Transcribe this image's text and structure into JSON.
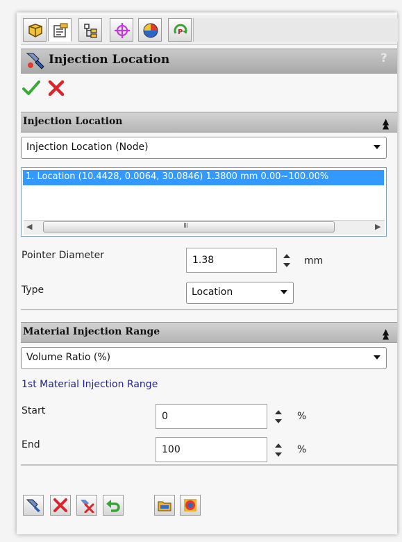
{
  "panel": {
    "title": "Injection Location",
    "help": "?"
  },
  "tabs": [
    {
      "icon": "feature-manager-icon"
    },
    {
      "icon": "property-manager-icon"
    },
    {
      "icon": "configuration-manager-icon"
    },
    {
      "icon": "dimxpert-icon"
    },
    {
      "icon": "display-manager-icon"
    },
    {
      "icon": "plastics-manager-icon"
    }
  ],
  "injection_location": {
    "section_title": "Injection Location",
    "mode_select": "Injection Location (Node)",
    "list_items": [
      "1. Location (10.4428, 0.0064, 30.0846) 1.3800 mm  0.00~100.00%"
    ],
    "scroll_grip": "III",
    "pointer_diameter_label": "Pointer Diameter",
    "pointer_diameter_value": "1.38",
    "pointer_diameter_unit": "mm",
    "type_label": "Type",
    "type_value": "Location"
  },
  "material_injection": {
    "section_title": "Material Injection Range",
    "mode_select": "Volume Ratio (%)",
    "range_label": "1st Material Injection Range",
    "start_label": "Start",
    "start_value": "0",
    "start_unit": "%",
    "end_label": "End",
    "end_value": "100",
    "end_unit": "%"
  },
  "colors": {
    "selection": "#3399ff",
    "ok_check": "#39a935",
    "cancel_x": "#d7262c",
    "range_label": "#23238f"
  }
}
